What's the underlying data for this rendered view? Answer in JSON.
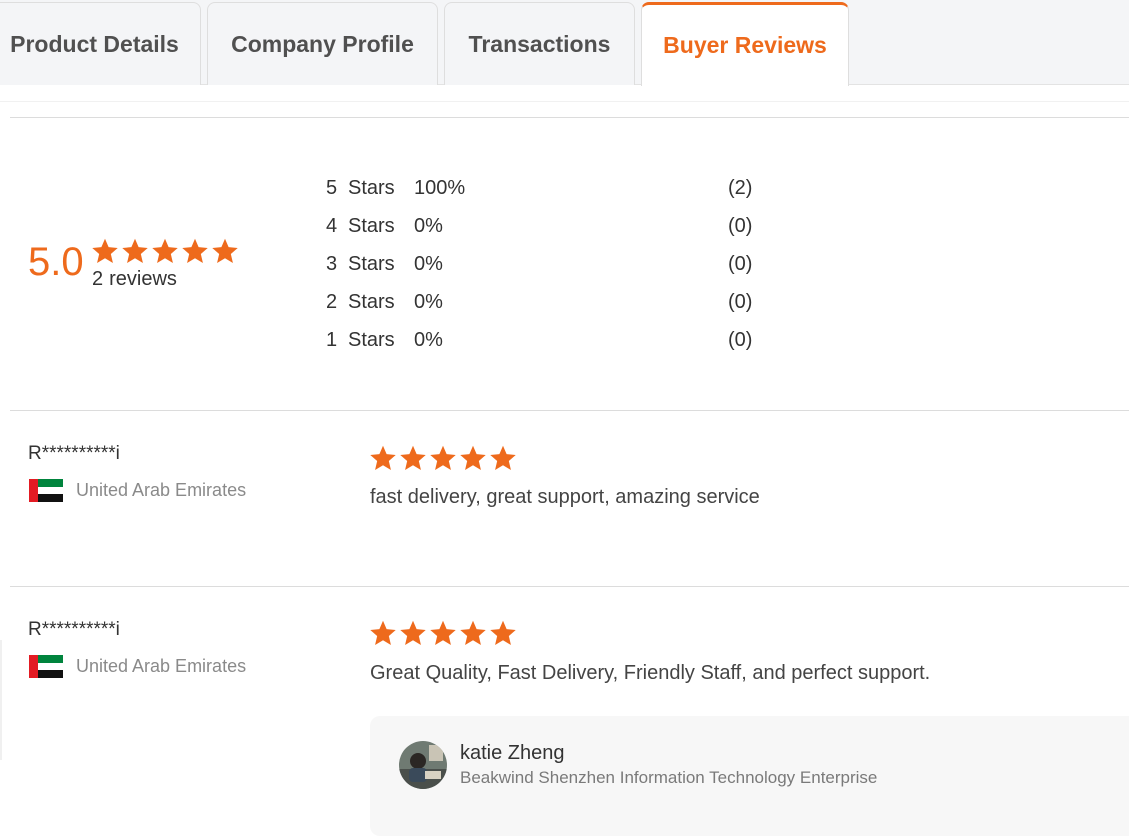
{
  "tabs": [
    {
      "label": "Product Details",
      "active": false
    },
    {
      "label": "Company Profile",
      "active": false
    },
    {
      "label": "Transactions",
      "active": false
    },
    {
      "label": "Buyer Reviews",
      "active": true
    }
  ],
  "summary": {
    "average": "5.0",
    "average_stars": 5,
    "review_count": "2",
    "review_count_label": "reviews",
    "distribution": [
      {
        "stars": "5",
        "label": "Stars",
        "percent": "100%",
        "count": "(2)"
      },
      {
        "stars": "4",
        "label": "Stars",
        "percent": "0%",
        "count": "(0)"
      },
      {
        "stars": "3",
        "label": "Stars",
        "percent": "0%",
        "count": "(0)"
      },
      {
        "stars": "2",
        "label": "Stars",
        "percent": "0%",
        "count": "(0)"
      },
      {
        "stars": "1",
        "label": "Stars",
        "percent": "0%",
        "count": "(0)"
      }
    ]
  },
  "reviews": [
    {
      "reviewer": "R**********i",
      "country": "United Arab Emirates",
      "flag_icon": "uae-flag-icon",
      "rating": 5,
      "text": "fast delivery, great support, amazing service"
    },
    {
      "reviewer": "R**********i",
      "country": "United Arab Emirates",
      "flag_icon": "uae-flag-icon",
      "rating": 5,
      "text": "Great Quality, Fast Delivery, Friendly Staff, and perfect support.",
      "reply": {
        "name": "katie Zheng",
        "company": "Beakwind Shenzhen Information Technology Enterprise"
      }
    }
  ],
  "colors": {
    "accent": "#ee6a1c",
    "text": "#333333",
    "muted": "#8a8a8a",
    "tab_bg": "#f4f5f7",
    "divider": "#dcdcdc"
  }
}
